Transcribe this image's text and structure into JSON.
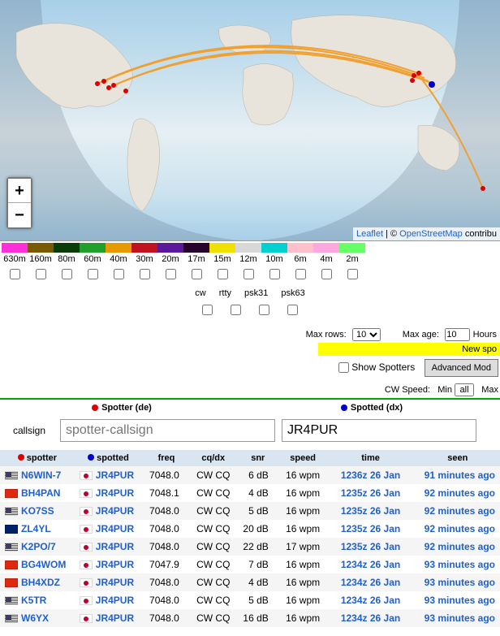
{
  "map": {
    "attrib_leaflet": "Leaflet",
    "attrib_sep": " | © ",
    "attrib_osm": "OpenStreetMap",
    "attrib_tail": " contribu",
    "zoom_in": "+",
    "zoom_out": "−"
  },
  "bands": [
    {
      "label": "630m",
      "color": "#ff2fd9"
    },
    {
      "label": "160m",
      "color": "#7a5a00"
    },
    {
      "label": "80m",
      "color": "#0b3d0b"
    },
    {
      "label": "60m",
      "color": "#1fa02a"
    },
    {
      "label": "40m",
      "color": "#e69a00"
    },
    {
      "label": "30m",
      "color": "#c1121f"
    },
    {
      "label": "20m",
      "color": "#5a189a"
    },
    {
      "label": "17m",
      "color": "#27042b"
    },
    {
      "label": "15m",
      "color": "#f0e000"
    },
    {
      "label": "12m",
      "color": "#d8d8d8"
    },
    {
      "label": "10m",
      "color": "#00d0d0"
    },
    {
      "label": "6m",
      "color": "#ffc0cb"
    },
    {
      "label": "4m",
      "color": "#ffa8e0"
    },
    {
      "label": "2m",
      "color": "#66ff66"
    }
  ],
  "modes": [
    "cw",
    "rtty",
    "psk31",
    "psk63"
  ],
  "controls": {
    "maxrows_label": "Max rows:",
    "maxrows_value": "10",
    "maxage_label": "Max age:",
    "maxage_value": "10",
    "maxage_unit": "Hours",
    "newspots": "New spo",
    "show_spotters": "Show Spotters",
    "advanced": "Advanced Mod",
    "cwspeed_label": "CW Speed:",
    "min_label": "Min",
    "min_value": "all",
    "max_label": "Max"
  },
  "legend": {
    "spotter": "Spotter (de)",
    "spotted": "Spotted (dx)"
  },
  "search": {
    "label": "callsign",
    "spotter_placeholder": "spotter-callsign",
    "spotted_value": "JR4PUR"
  },
  "columns": {
    "spotter": "spotter",
    "spotted": "spotted",
    "freq": "freq",
    "cqdx": "cq/dx",
    "snr": "snr",
    "speed": "speed",
    "time": "time",
    "seen": "seen"
  },
  "rows": [
    {
      "flag_de": "us",
      "de": "N6WIN-7",
      "flag_dx": "jp",
      "dx": "JR4PUR",
      "freq": "7048.0",
      "cq": "CW CQ",
      "snr": "6 dB",
      "spd": "16 wpm",
      "time": "1236z 26 Jan",
      "seen": "91 minutes ago"
    },
    {
      "flag_de": "cn",
      "de": "BH4PAN",
      "flag_dx": "jp",
      "dx": "JR4PUR",
      "freq": "7048.1",
      "cq": "CW CQ",
      "snr": "4 dB",
      "spd": "16 wpm",
      "time": "1235z 26 Jan",
      "seen": "92 minutes ago"
    },
    {
      "flag_de": "us",
      "de": "KO7SS",
      "flag_dx": "jp",
      "dx": "JR4PUR",
      "freq": "7048.0",
      "cq": "CW CQ",
      "snr": "5 dB",
      "spd": "16 wpm",
      "time": "1235z 26 Jan",
      "seen": "92 minutes ago"
    },
    {
      "flag_de": "nz",
      "de": "ZL4YL",
      "flag_dx": "jp",
      "dx": "JR4PUR",
      "freq": "7048.0",
      "cq": "CW CQ",
      "snr": "20 dB",
      "spd": "16 wpm",
      "time": "1235z 26 Jan",
      "seen": "92 minutes ago"
    },
    {
      "flag_de": "us",
      "de": "K2PO/7",
      "flag_dx": "jp",
      "dx": "JR4PUR",
      "freq": "7048.0",
      "cq": "CW CQ",
      "snr": "22 dB",
      "spd": "17 wpm",
      "time": "1235z 26 Jan",
      "seen": "92 minutes ago"
    },
    {
      "flag_de": "cn",
      "de": "BG4WOM",
      "flag_dx": "jp",
      "dx": "JR4PUR",
      "freq": "7047.9",
      "cq": "CW CQ",
      "snr": "7 dB",
      "spd": "16 wpm",
      "time": "1234z 26 Jan",
      "seen": "93 minutes ago"
    },
    {
      "flag_de": "cn",
      "de": "BH4XDZ",
      "flag_dx": "jp",
      "dx": "JR4PUR",
      "freq": "7048.0",
      "cq": "CW CQ",
      "snr": "4 dB",
      "spd": "16 wpm",
      "time": "1234z 26 Jan",
      "seen": "93 minutes ago"
    },
    {
      "flag_de": "us",
      "de": "K5TR",
      "flag_dx": "jp",
      "dx": "JR4PUR",
      "freq": "7048.0",
      "cq": "CW CQ",
      "snr": "5 dB",
      "spd": "16 wpm",
      "time": "1234z 26 Jan",
      "seen": "93 minutes ago"
    },
    {
      "flag_de": "us",
      "de": "W6YX",
      "flag_dx": "jp",
      "dx": "JR4PUR",
      "freq": "7048.0",
      "cq": "CW CQ",
      "snr": "16 dB",
      "spd": "16 wpm",
      "time": "1234z 26 Jan",
      "seen": "93 minutes ago"
    }
  ]
}
